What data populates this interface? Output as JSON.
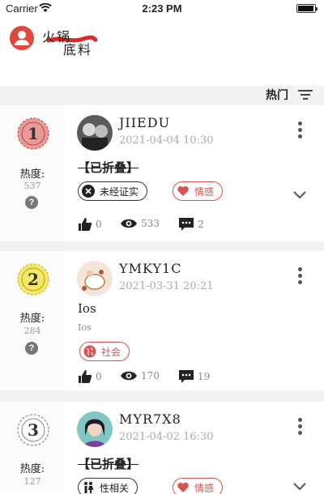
{
  "status": {
    "carrier": "Carrier",
    "time": "2:23 PM"
  },
  "header": {
    "logo_line1": "火锅",
    "logo_line2": "底料"
  },
  "sort": {
    "label": "热门"
  },
  "heat_label": "热度:",
  "help_glyph": "?",
  "posts": [
    {
      "rank": "1",
      "heat": "537",
      "rank_color": "#e89a96",
      "user": "JIIEDU",
      "date": "2021-04-04 10:30",
      "folded_text": "【已折叠】",
      "tags": [
        {
          "label": "未经证实",
          "icon": "close-circle-icon",
          "style": "dark"
        },
        {
          "label": "情感",
          "icon": "heart-icon",
          "style": "red"
        }
      ],
      "likes": "0",
      "views": "533",
      "comments": "2"
    },
    {
      "rank": "2",
      "heat": "284",
      "rank_color": "#f4e76a",
      "user": "YMKY1C",
      "date": "2021-03-31 20:21",
      "title": "Ios",
      "subtitle": "Ios",
      "tags": [
        {
          "label": "社会",
          "icon": "globe-icon",
          "style": "red"
        }
      ],
      "likes": "0",
      "views": "170",
      "comments": "19"
    },
    {
      "rank": "3",
      "heat": "127",
      "rank_color": "#ffffff",
      "user": "MYR7X8",
      "date": "2021-04-02 16:30",
      "folded_text": "【已折叠】",
      "tags": [
        {
          "label": "性相关",
          "icon": "people-icon",
          "style": "dark"
        },
        {
          "label": "情感",
          "icon": "heart-icon",
          "style": "red"
        }
      ]
    }
  ]
}
